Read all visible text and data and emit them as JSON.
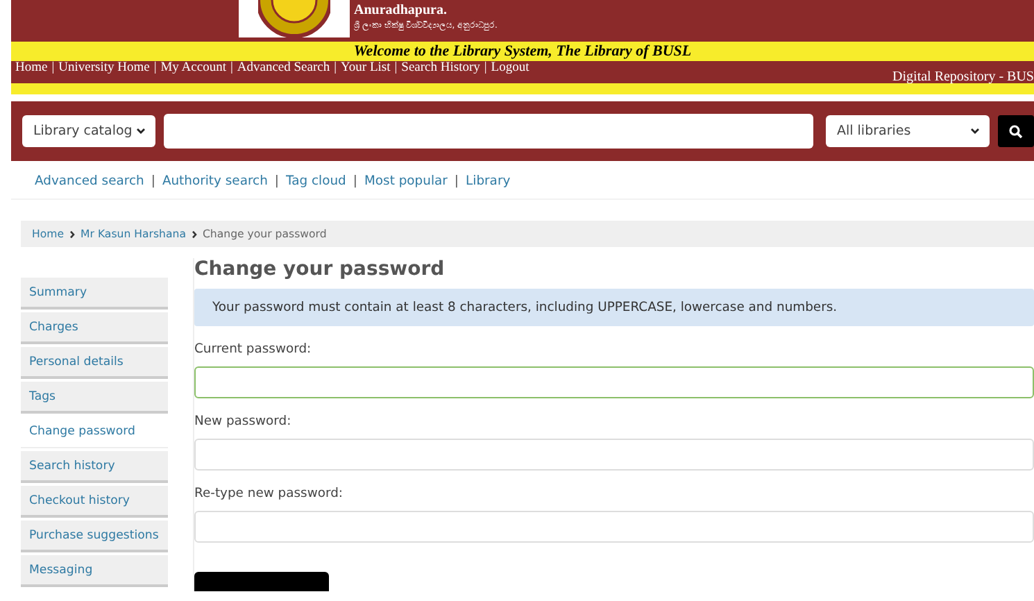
{
  "header": {
    "university_name": "Anuradhapura.",
    "university_name_sinhala": "ශ්‍රී ලංකා භික්ෂු විශ්වවිද්‍යාලය, අනුරාධපුර.",
    "welcome": "Welcome to the Library System, The Library of BUSL",
    "separator": "|",
    "nav_links": [
      "Home",
      "University Home",
      "My Account",
      "Advanced Search",
      "Your List",
      "Search History",
      "Logout"
    ],
    "repository_link": "Digital Repository - BUS"
  },
  "search": {
    "catalog_select": "Library catalog",
    "library_select": "All libraries"
  },
  "quick_links_separator": "|",
  "quick_links": [
    "Advanced search",
    "Authority search",
    "Tag cloud",
    "Most popular",
    "Library"
  ],
  "breadcrumbs": [
    "Home",
    "Mr Kasun Harshana",
    "Change your password"
  ],
  "sidebar": {
    "items": [
      {
        "label": "Summary",
        "selected": false
      },
      {
        "label": "Charges",
        "selected": false
      },
      {
        "label": "Personal details",
        "selected": false
      },
      {
        "label": "Tags",
        "selected": false
      },
      {
        "label": "Change password",
        "selected": true
      },
      {
        "label": "Search history",
        "selected": false
      },
      {
        "label": "Checkout history",
        "selected": false
      },
      {
        "label": "Purchase suggestions",
        "selected": false
      },
      {
        "label": "Messaging",
        "selected": false
      }
    ]
  },
  "main": {
    "title": "Change your password",
    "notice": "Your password must contain at least 8 characters, including UPPERCASE, lowercase and numbers.",
    "fields": [
      {
        "label": "Current password:",
        "focused": true
      },
      {
        "label": "New password:",
        "focused": false
      },
      {
        "label": "Re-type new password:",
        "focused": false
      }
    ]
  }
}
